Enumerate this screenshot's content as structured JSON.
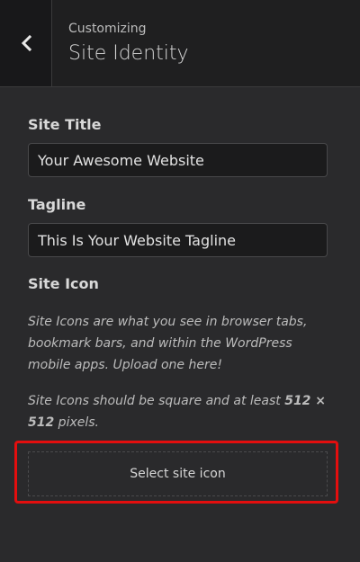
{
  "header": {
    "subtitle": "Customizing",
    "title": "Site Identity"
  },
  "site_title": {
    "label": "Site Title",
    "value": "Your Awesome Website"
  },
  "tagline": {
    "label": "Tagline",
    "value": "This Is Your Website Tagline"
  },
  "site_icon": {
    "label": "Site Icon",
    "description_1": "Site Icons are what you see in browser tabs, bookmark bars, and within the WordPress mobile apps. Upload one here!",
    "description_2_prefix": "Site Icons should be square and at least ",
    "description_2_size": "512 × 512",
    "description_2_suffix": " pixels.",
    "select_button": "Select site icon"
  },
  "colors": {
    "highlight": "#e30e0e"
  },
  "icons": {
    "back": "chevron-left-icon"
  }
}
